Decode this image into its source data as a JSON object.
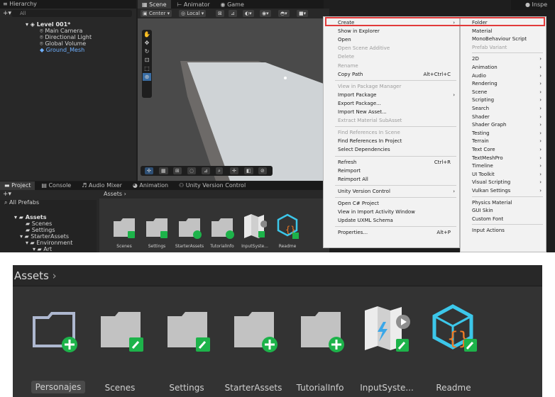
{
  "hierarchy": {
    "tab": "Hierarchy",
    "search_placeholder": "All",
    "items": [
      "Level 001*",
      "Main Camera",
      "Directional Light",
      "Global Volume",
      "Ground_Mesh"
    ]
  },
  "scene_tabs": [
    "Scene",
    "Animator",
    "Game"
  ],
  "scene_toolbar": {
    "pivot": "Center",
    "space": "Local"
  },
  "inspector_tab": "Inspe",
  "project": {
    "tabs": [
      "Project",
      "Console",
      "Audio Mixer",
      "Animation",
      "Unity Version Control"
    ],
    "favorites": "All Prefabs",
    "breadcrumb": "Assets",
    "tree": [
      "Assets",
      "Scenes",
      "Settings",
      "StarterAssets",
      "Environment",
      "Art"
    ],
    "items": [
      "Scenes",
      "Settings",
      "StarterAssets",
      "TutorialInfo",
      "InputSyste...",
      "Readme"
    ]
  },
  "context_menu": [
    {
      "label": "Create",
      "arrow": true
    },
    {
      "label": "Show in Explorer"
    },
    {
      "label": "Open"
    },
    {
      "label": "Open Scene Additive",
      "disabled": true
    },
    {
      "label": "Delete",
      "disabled": true
    },
    {
      "label": "Rename",
      "disabled": true
    },
    {
      "label": "Copy Path",
      "shortcut": "Alt+Ctrl+C"
    },
    {
      "sep": true
    },
    {
      "label": "View in Package Manager",
      "disabled": true
    },
    {
      "label": "Import Package",
      "arrow": true
    },
    {
      "label": "Export Package..."
    },
    {
      "label": "Import New Asset..."
    },
    {
      "label": "Extract Material SubAsset",
      "disabled": true
    },
    {
      "sep": true
    },
    {
      "label": "Find References In Scene",
      "disabled": true
    },
    {
      "label": "Find References In Project"
    },
    {
      "label": "Select Dependencies"
    },
    {
      "sep": true
    },
    {
      "label": "Refresh",
      "shortcut": "Ctrl+R"
    },
    {
      "label": "Reimport"
    },
    {
      "label": "Reimport All"
    },
    {
      "sep": true
    },
    {
      "label": "Unity Version Control",
      "arrow": true
    },
    {
      "sep": true
    },
    {
      "label": "Open C# Project"
    },
    {
      "label": "View in Import Activity Window"
    },
    {
      "label": "Update UXML Schema"
    },
    {
      "sep": true
    },
    {
      "label": "Properties...",
      "shortcut": "Alt+P"
    }
  ],
  "create_submenu": [
    {
      "label": "Folder"
    },
    {
      "label": "Material"
    },
    {
      "label": "MonoBehaviour Script"
    },
    {
      "label": "Prefab Variant",
      "disabled": true
    },
    {
      "sep": true
    },
    {
      "label": "2D",
      "arrow": true
    },
    {
      "label": "Animation",
      "arrow": true
    },
    {
      "label": "Audio",
      "arrow": true
    },
    {
      "label": "Rendering",
      "arrow": true
    },
    {
      "label": "Scene",
      "arrow": true
    },
    {
      "label": "Scripting",
      "arrow": true
    },
    {
      "label": "Search",
      "arrow": true
    },
    {
      "label": "Shader",
      "arrow": true
    },
    {
      "label": "Shader Graph",
      "arrow": true
    },
    {
      "label": "Testing",
      "arrow": true
    },
    {
      "label": "Terrain",
      "arrow": true
    },
    {
      "label": "Text Core",
      "arrow": true
    },
    {
      "label": "TextMeshPro",
      "arrow": true
    },
    {
      "label": "Timeline",
      "arrow": true
    },
    {
      "label": "UI Toolkit",
      "arrow": true
    },
    {
      "label": "Visual Scripting",
      "arrow": true
    },
    {
      "label": "Vulkan Settings",
      "arrow": true
    },
    {
      "sep": true
    },
    {
      "label": "Physics Material"
    },
    {
      "label": "GUI Skin"
    },
    {
      "label": "Custom Font"
    },
    {
      "sep": true
    },
    {
      "label": "Input Actions"
    }
  ],
  "zoom_panel": {
    "breadcrumb": "Assets",
    "items": [
      "Personajes",
      "Scenes",
      "Settings",
      "StarterAssets",
      "TutorialInfo",
      "InputSyste...",
      "Readme"
    ],
    "selected": "Personajes"
  },
  "colors": {
    "highlight": "#e23a3a",
    "badge_green": "#1db34a",
    "selection_blue": "#5aa9f5",
    "readme_cyan": "#3cc7ea",
    "readme_orange": "#f07a24"
  }
}
